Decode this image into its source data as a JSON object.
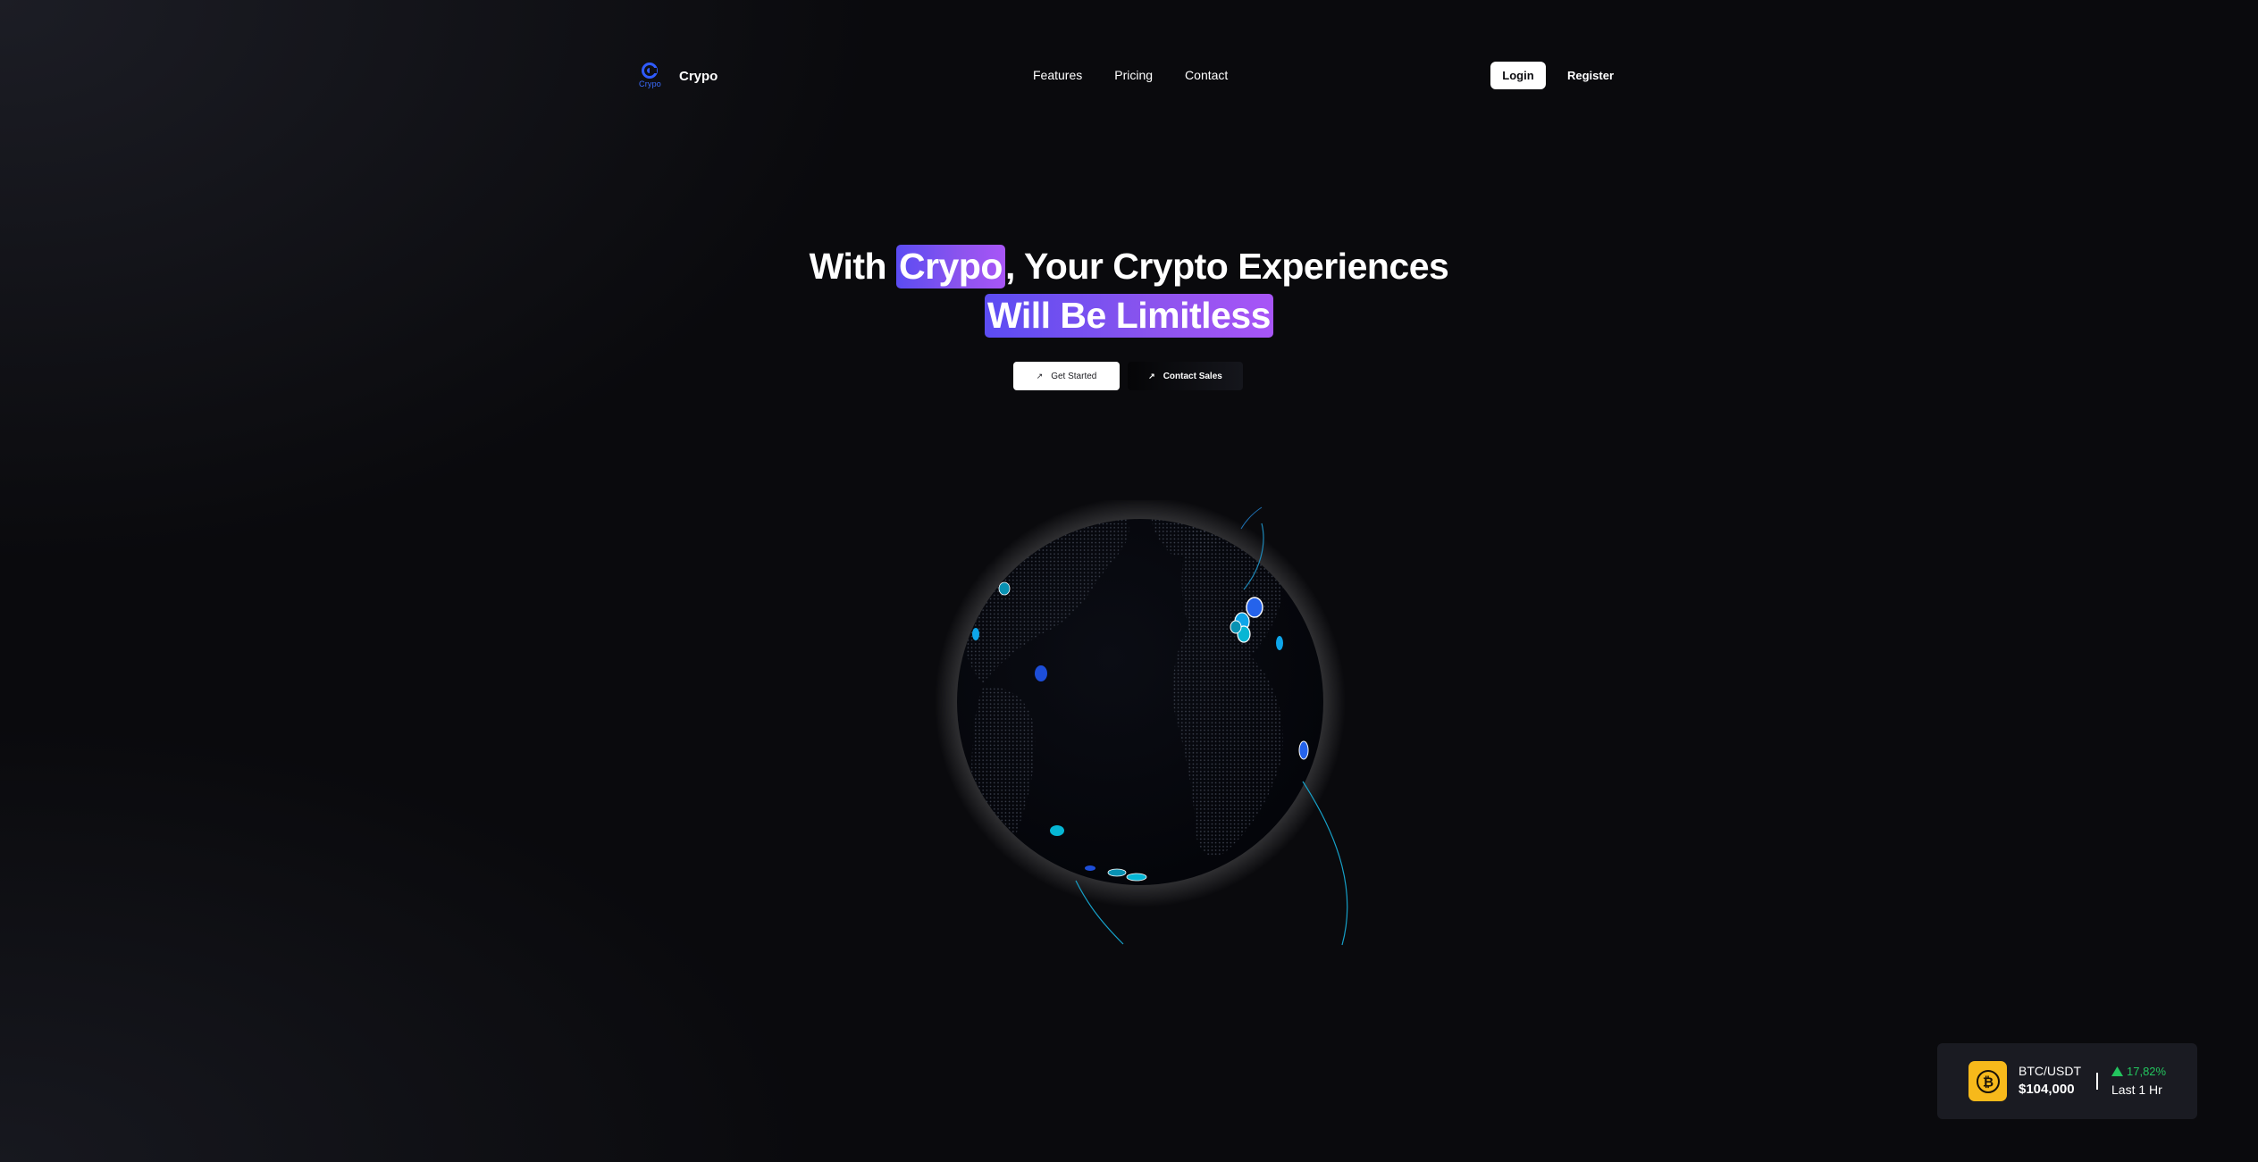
{
  "brand": {
    "name": "Crypo",
    "logo_subtext": "Crypo",
    "logo_color": "#2f5bff"
  },
  "nav": {
    "links": [
      "Features",
      "Pricing",
      "Contact"
    ],
    "login_label": "Login",
    "register_label": "Register"
  },
  "hero": {
    "line1_prefix": "With",
    "line1_highlight": "Crypo",
    "line1_suffix": ", Your Crypto Experiences",
    "line2_highlight": "Will Be Limitless",
    "highlight_color_start": "#5b4cf2",
    "highlight_color_end": "#a855f7",
    "primary_cta": "Get Started",
    "secondary_cta": "Contact Sales"
  },
  "ticker": {
    "pair": "BTC/USDT",
    "price": "$104,000",
    "change": "17,82%",
    "period": "Last 1 Hr",
    "coin_icon": "bitcoin-icon",
    "coin_color": "#f7b91b",
    "change_color": "#23c55e"
  }
}
